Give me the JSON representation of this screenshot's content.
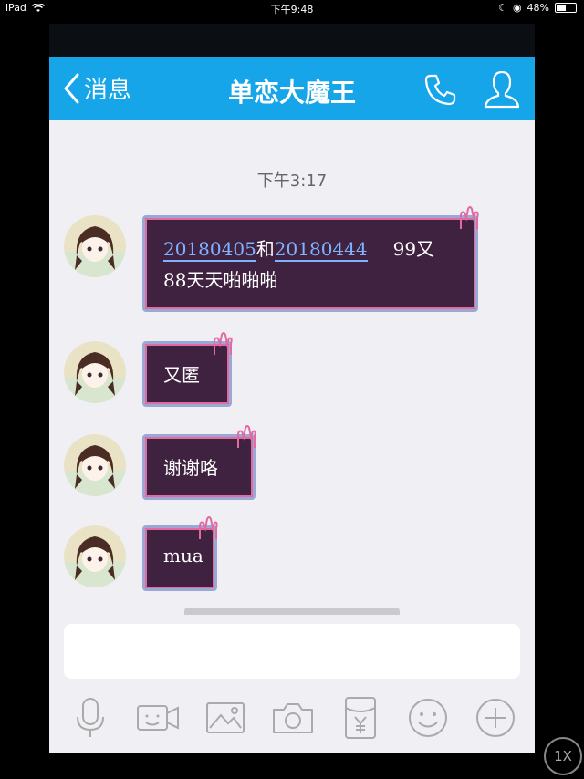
{
  "status_bar": {
    "device": "iPad",
    "time": "下午9:48",
    "battery": "48%"
  },
  "navbar": {
    "back_label": "消息",
    "title": "单恋大魔王"
  },
  "chat": {
    "timestamp": "下午3:17",
    "messages": [
      {
        "line1_part1": "20180405",
        "line1_part2": "和",
        "line1_part3": "20180444",
        "line1_part4": "99又",
        "line2": "88天天啪啪啪"
      },
      {
        "text": "又匿"
      },
      {
        "text": "谢谢咯"
      },
      {
        "text": "mua"
      }
    ]
  },
  "input": {
    "placeholder": ""
  },
  "toolbar": [
    "microphone-icon",
    "video-call-icon",
    "image-icon",
    "camera-icon",
    "red-packet-icon",
    "emoji-icon",
    "plus-icon"
  ],
  "overlay": {
    "zoom_label": "1X"
  },
  "colors": {
    "nav_blue": "#17a5ea",
    "bubble_bg": "#3f2140",
    "link_blue": "#7fb3ff"
  }
}
